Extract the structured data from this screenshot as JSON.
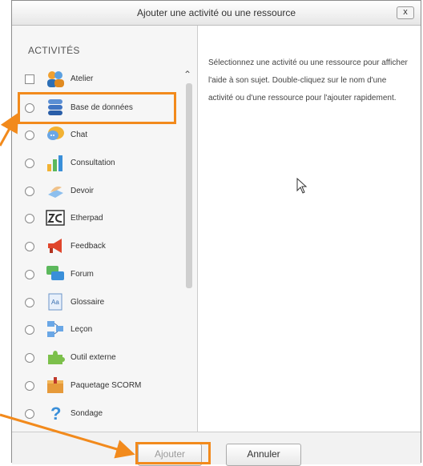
{
  "dialog": {
    "title": "Ajouter une activité ou une ressource",
    "close_label": "x"
  },
  "chooser": {
    "heading": "ACTIVITÉS",
    "items": [
      {
        "label": "Atelier",
        "icon": "workshop-icon",
        "control": "checkbox"
      },
      {
        "label": "Base de données",
        "icon": "database-icon",
        "control": "radio"
      },
      {
        "label": "Chat",
        "icon": "chat-icon",
        "control": "radio"
      },
      {
        "label": "Consultation",
        "icon": "poll-chart-icon",
        "control": "radio"
      },
      {
        "label": "Devoir",
        "icon": "assignment-icon",
        "control": "radio"
      },
      {
        "label": "Etherpad",
        "icon": "etherpad-icon",
        "control": "radio"
      },
      {
        "label": "Feedback",
        "icon": "megaphone-icon",
        "control": "radio"
      },
      {
        "label": "Forum",
        "icon": "forum-icon",
        "control": "radio"
      },
      {
        "label": "Glossaire",
        "icon": "glossary-icon",
        "control": "radio"
      },
      {
        "label": "Leçon",
        "icon": "lesson-icon",
        "control": "radio"
      },
      {
        "label": "Outil externe",
        "icon": "puzzle-icon",
        "control": "radio"
      },
      {
        "label": "Paquetage SCORM",
        "icon": "scorm-package-icon",
        "control": "radio"
      },
      {
        "label": "Sondage",
        "icon": "question-icon",
        "control": "radio"
      }
    ]
  },
  "help": {
    "text": "Sélectionnez une activité ou une ressource pour afficher l'aide à son sujet. Double-cliquez sur le nom d'une activité ou d'une ressource pour l'ajouter rapidement."
  },
  "footer": {
    "add_label": "Ajouter",
    "cancel_label": "Annuler"
  },
  "colors": {
    "highlight": "#f28a1c"
  }
}
